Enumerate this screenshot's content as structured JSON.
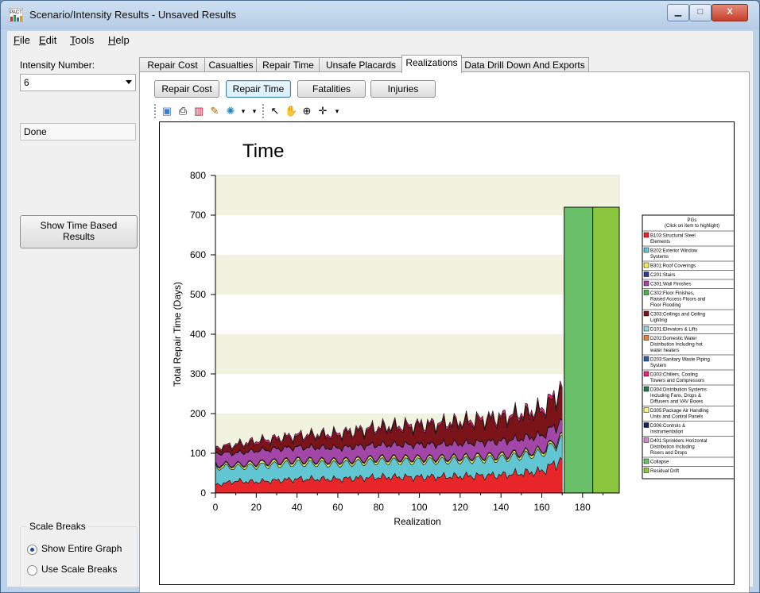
{
  "window": {
    "title": "Scenario/Intensity Results - Unsaved Results",
    "app_icon_text": "PACT"
  },
  "controls": {
    "minimize": "▁",
    "maximize": "□",
    "close": "X"
  },
  "menu": [
    {
      "label": "File",
      "key": "F"
    },
    {
      "label": "Edit",
      "key": "E"
    },
    {
      "label": "Tools",
      "key": "T"
    },
    {
      "label": "Help",
      "key": "H"
    }
  ],
  "left": {
    "intensity_label": "Intensity Number:",
    "intensity_value": "6",
    "status": "Done",
    "show_time_button": "Show Time Based Results",
    "scale_breaks_title": "Scale Breaks",
    "radio_entire": "Show Entire Graph",
    "radio_breaks": "Use Scale Breaks",
    "selected_radio": "Show Entire Graph"
  },
  "tabs": [
    "Repair Cost",
    "Casualties",
    "Repair Time",
    "Unsafe Placards",
    "Realizations",
    "Data Drill Down And Exports"
  ],
  "active_tab": "Realizations",
  "sub_buttons": [
    "Repair Cost",
    "Repair Time",
    "Fatalities",
    "Injuries"
  ],
  "active_sub_button": "Repair Time",
  "toolbar_icons": [
    "image-icon",
    "print-icon",
    "chart-gallery-icon",
    "palette-icon",
    "color-wheel-icon",
    "pointer-icon",
    "hand-pan-icon",
    "zoom-icon",
    "move-axis-icon"
  ],
  "chart_data": {
    "type": "area",
    "title": "Time",
    "xlabel": "Realization",
    "ylabel": "Total Repair Time (Days)",
    "xlim": [
      0,
      198
    ],
    "ylim": [
      0,
      800
    ],
    "xticks": [
      0,
      20,
      40,
      60,
      80,
      100,
      120,
      140,
      160,
      180
    ],
    "yticks": [
      0,
      100,
      200,
      300,
      400,
      500,
      600,
      700,
      800
    ],
    "banded_grid_color": "#f1f3de",
    "series": [
      {
        "name": "B103:Structural Steel Elements",
        "color": "#e8262a",
        "x": [
          0,
          10,
          20,
          40,
          60,
          80,
          100,
          120,
          140,
          160,
          170
        ],
        "values": [
          20,
          30,
          28,
          35,
          35,
          40,
          40,
          42,
          45,
          55,
          85
        ]
      },
      {
        "name": "B202:Exterior Window Systems",
        "color": "#61c6d2",
        "x": [
          0,
          10,
          20,
          40,
          60,
          80,
          100,
          120,
          140,
          160,
          170
        ],
        "values": [
          45,
          35,
          40,
          40,
          38,
          40,
          40,
          40,
          42,
          45,
          50
        ]
      },
      {
        "name": "B301:Roof Coverings",
        "color": "#f3ec58",
        "x": [
          0,
          10,
          20,
          40,
          60,
          80,
          100,
          120,
          140,
          160,
          170
        ],
        "values": [
          5,
          5,
          6,
          6,
          6,
          6,
          6,
          6,
          6,
          6,
          6
        ]
      },
      {
        "name": "C201:Stairs",
        "color": "#2a3f8c",
        "x": [
          0,
          10,
          20,
          40,
          60,
          80,
          100,
          120,
          140,
          160,
          170
        ],
        "values": [
          2,
          2,
          2,
          2,
          2,
          2,
          2,
          2,
          2,
          2,
          2
        ]
      },
      {
        "name": "C301:Wall Finishes",
        "color": "#a246a8",
        "x": [
          0,
          10,
          20,
          40,
          60,
          80,
          100,
          120,
          140,
          160,
          170
        ],
        "values": [
          28,
          28,
          30,
          32,
          32,
          33,
          33,
          34,
          35,
          36,
          38
        ]
      },
      {
        "name": "C302:Floor Finishes, Raised Access Floors and Floor Flooding",
        "color": "#4fb04b",
        "x": [
          0,
          10,
          20,
          40,
          60,
          80,
          100,
          120,
          140,
          160,
          170
        ],
        "values": [
          1,
          1,
          1,
          1,
          1,
          1,
          1,
          1,
          1,
          1,
          1
        ]
      },
      {
        "name": "C303:Ceilings and Ceiling Lighting",
        "color": "#7a1418",
        "x": [
          0,
          10,
          20,
          40,
          60,
          80,
          100,
          120,
          140,
          160,
          170
        ],
        "values": [
          10,
          18,
          20,
          25,
          32,
          40,
          45,
          50,
          55,
          60,
          75
        ]
      },
      {
        "name": "D101:Elevators & Lifts",
        "color": "#9ad7e4",
        "x": [
          0,
          170
        ],
        "values": [
          0,
          0
        ]
      },
      {
        "name": "D202:Domestic Water Distribution Including hot water heaters",
        "color": "#f08030",
        "x": [
          0,
          170
        ],
        "values": [
          0,
          0
        ]
      },
      {
        "name": "D203:Sanitary Waste Piping System",
        "color": "#2f5da8",
        "x": [
          0,
          170
        ],
        "values": [
          0,
          0
        ]
      },
      {
        "name": "D303:Chillers, Cooling Towers and Compressors",
        "color": "#e8237e",
        "x": [
          0,
          10,
          20,
          40,
          60,
          80,
          100,
          120,
          140,
          160,
          170
        ],
        "values": [
          4,
          4,
          5,
          5,
          5,
          5,
          6,
          6,
          7,
          8,
          10
        ]
      },
      {
        "name": "D304:Distribution Systems Including Fans, Drops & Diffusers and VAV Boxes",
        "color": "#1e7b44",
        "x": [
          0,
          170
        ],
        "values": [
          0,
          0
        ]
      },
      {
        "name": "D305:Package Air Handling Units and Control Panels",
        "color": "#f7f08a",
        "x": [
          0,
          170
        ],
        "values": [
          0,
          0
        ]
      },
      {
        "name": "D306:Controls & Instrumentation",
        "color": "#1c1c6c",
        "x": [
          0,
          170
        ],
        "values": [
          0,
          0
        ]
      },
      {
        "name": "D401:Sprinklers Horizontal Distribution Including Risers and Drops",
        "color": "#d08cc6",
        "x": [
          0,
          170
        ],
        "values": [
          0,
          0
        ]
      },
      {
        "name": "Collapse",
        "color": "#6abf69",
        "bars": [
          {
            "x0": 171,
            "x1": 185,
            "value": 720
          }
        ]
      },
      {
        "name": "Residual Drift",
        "color": "#8cc63f",
        "bars": [
          {
            "x0": 185,
            "x1": 198,
            "value": 720
          }
        ]
      }
    ],
    "legend": {
      "title": "PGs",
      "subtitle": "(Click on item to highlight)",
      "placement": "right"
    }
  }
}
